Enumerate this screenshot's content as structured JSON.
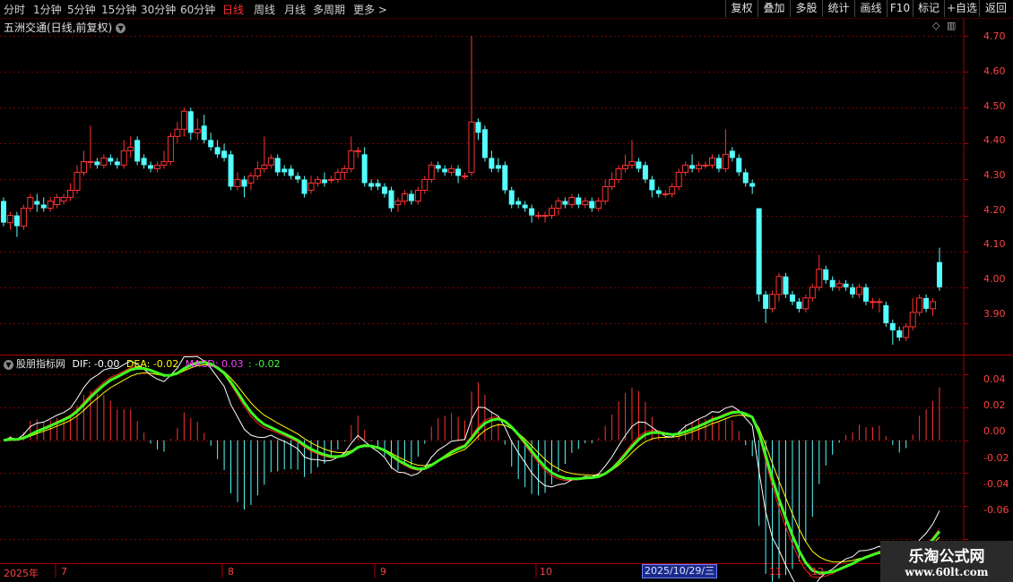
{
  "toolbar": {
    "periods": [
      "分时",
      "1分钟",
      "5分钟",
      "15分钟",
      "30分钟",
      "60分钟",
      "日线",
      "周线",
      "月线",
      "多周期",
      "更多 >"
    ],
    "active_period": "日线",
    "buttons": [
      "复权",
      "叠加",
      "多股",
      "统计",
      "画线",
      "F10",
      "标记",
      "+自选",
      "返回"
    ]
  },
  "stock_title": "五洲交通(日线,前复权)",
  "indicator": {
    "name": "股朋指标网",
    "dif_text": "DIF: -0.00",
    "dea_text": "DEA: -0.02",
    "macd_text": "MACD: 0.03",
    "extra_text": ": -0.02",
    "colors": {
      "dif": "#ffffff",
      "dea": "#ffff00",
      "macd": "#ff40ff",
      "extra": "#40ff40"
    }
  },
  "price_axis": [
    "4.70",
    "4.60",
    "4.50",
    "4.40",
    "4.30",
    "4.20",
    "4.10",
    "4.00",
    "3.90"
  ],
  "macd_axis": [
    "0.04",
    "0.02",
    "0.00",
    "-0.02",
    "-0.04",
    "-0.06"
  ],
  "x_axis": [
    "2025年",
    "7",
    "8",
    "9",
    "10",
    "11",
    "12"
  ],
  "cursor_date": "2025/10/29/三",
  "watermark": {
    "line1": "乐淘公式网",
    "line2": "www.60lt.com"
  },
  "colors": {
    "up": "#ff3232",
    "down": "#54ffff",
    "bg": "#000000",
    "grid": "#7a0000"
  },
  "chart_data": [
    {
      "type": "candlestick",
      "title": "五洲交通(日线,前复权)",
      "ylim": [
        3.82,
        4.72
      ],
      "candles": [
        [
          4.24,
          4.18,
          4.25,
          4.17
        ],
        [
          4.18,
          4.2,
          4.21,
          4.16
        ],
        [
          4.2,
          4.17,
          4.21,
          4.14
        ],
        [
          4.17,
          4.22,
          4.23,
          4.16
        ],
        [
          4.22,
          4.25,
          4.26,
          4.21
        ],
        [
          4.24,
          4.23,
          4.26,
          4.21
        ],
        [
          4.23,
          4.22,
          4.25,
          4.21
        ],
        [
          4.22,
          4.24,
          4.25,
          4.21
        ],
        [
          4.23,
          4.25,
          4.26,
          4.22
        ],
        [
          4.24,
          4.25,
          4.26,
          4.23
        ],
        [
          4.25,
          4.27,
          4.29,
          4.24
        ],
        [
          4.27,
          4.32,
          4.34,
          4.26
        ],
        [
          4.32,
          4.35,
          4.38,
          4.31
        ],
        [
          4.35,
          4.35,
          4.45,
          4.33
        ],
        [
          4.35,
          4.34,
          4.36,
          4.33
        ],
        [
          4.34,
          4.36,
          4.37,
          4.33
        ],
        [
          4.36,
          4.35,
          4.37,
          4.34
        ],
        [
          4.35,
          4.34,
          4.36,
          4.33
        ],
        [
          4.34,
          4.38,
          4.41,
          4.33
        ],
        [
          4.38,
          4.39,
          4.42,
          4.36
        ],
        [
          4.41,
          4.35,
          4.42,
          4.34
        ],
        [
          4.36,
          4.34,
          4.37,
          4.33
        ],
        [
          4.34,
          4.33,
          4.35,
          4.32
        ],
        [
          4.33,
          4.34,
          4.35,
          4.32
        ],
        [
          4.34,
          4.35,
          4.38,
          4.33
        ],
        [
          4.35,
          4.42,
          4.43,
          4.34
        ],
        [
          4.42,
          4.44,
          4.46,
          4.4
        ],
        [
          4.44,
          4.49,
          4.5,
          4.42
        ],
        [
          4.49,
          4.43,
          4.5,
          4.41
        ],
        [
          4.43,
          4.44,
          4.47,
          4.41
        ],
        [
          4.45,
          4.41,
          4.48,
          4.4
        ],
        [
          4.41,
          4.39,
          4.43,
          4.38
        ],
        [
          4.39,
          4.37,
          4.41,
          4.36
        ],
        [
          4.38,
          4.36,
          4.4,
          4.35
        ],
        [
          4.37,
          4.28,
          4.38,
          4.27
        ],
        [
          4.28,
          4.3,
          4.32,
          4.27
        ],
        [
          4.3,
          4.28,
          4.31,
          4.25
        ],
        [
          4.29,
          4.31,
          4.32,
          4.27
        ],
        [
          4.31,
          4.33,
          4.35,
          4.3
        ],
        [
          4.33,
          4.34,
          4.42,
          4.32
        ],
        [
          4.34,
          4.36,
          4.37,
          4.33
        ],
        [
          4.36,
          4.32,
          4.37,
          4.31
        ],
        [
          4.33,
          4.32,
          4.34,
          4.31
        ],
        [
          4.33,
          4.31,
          4.34,
          4.3
        ],
        [
          4.31,
          4.3,
          4.32,
          4.29
        ],
        [
          4.3,
          4.26,
          4.31,
          4.25
        ],
        [
          4.27,
          4.29,
          4.31,
          4.26
        ],
        [
          4.29,
          4.3,
          4.31,
          4.28
        ],
        [
          4.3,
          4.29,
          4.32,
          4.28
        ],
        [
          4.3,
          4.3,
          4.31,
          4.29
        ],
        [
          4.3,
          4.32,
          4.33,
          4.29
        ],
        [
          4.32,
          4.33,
          4.34,
          4.3
        ],
        [
          4.33,
          4.38,
          4.42,
          4.32
        ],
        [
          4.38,
          4.38,
          4.39,
          4.36
        ],
        [
          4.37,
          4.29,
          4.39,
          4.28
        ],
        [
          4.29,
          4.28,
          4.3,
          4.27
        ],
        [
          4.29,
          4.28,
          4.3,
          4.27
        ],
        [
          4.28,
          4.26,
          4.29,
          4.25
        ],
        [
          4.27,
          4.22,
          4.28,
          4.21
        ],
        [
          4.23,
          4.24,
          4.25,
          4.21
        ],
        [
          4.24,
          4.26,
          4.27,
          4.23
        ],
        [
          4.26,
          4.24,
          4.27,
          4.23
        ],
        [
          4.24,
          4.27,
          4.28,
          4.23
        ],
        [
          4.27,
          4.3,
          4.31,
          4.26
        ],
        [
          4.3,
          4.34,
          4.35,
          4.29
        ],
        [
          4.34,
          4.33,
          4.35,
          4.32
        ],
        [
          4.33,
          4.32,
          4.34,
          4.31
        ],
        [
          4.32,
          4.33,
          4.34,
          4.31
        ],
        [
          4.33,
          4.31,
          4.34,
          4.29
        ],
        [
          4.31,
          4.31,
          4.32,
          4.3
        ],
        [
          4.32,
          4.46,
          4.7,
          4.31
        ],
        [
          4.46,
          4.43,
          4.47,
          4.41
        ],
        [
          4.44,
          4.36,
          4.45,
          4.35
        ],
        [
          4.36,
          4.33,
          4.38,
          4.32
        ],
        [
          4.34,
          4.33,
          4.36,
          4.32
        ],
        [
          4.34,
          4.27,
          4.35,
          4.26
        ],
        [
          4.27,
          4.23,
          4.28,
          4.22
        ],
        [
          4.24,
          4.23,
          4.25,
          4.22
        ],
        [
          4.23,
          4.22,
          4.24,
          4.21
        ],
        [
          4.22,
          4.2,
          4.23,
          4.18
        ],
        [
          4.2,
          4.2,
          4.21,
          4.19
        ],
        [
          4.2,
          4.2,
          4.21,
          4.18
        ],
        [
          4.2,
          4.22,
          4.23,
          4.19
        ],
        [
          4.22,
          4.24,
          4.25,
          4.2
        ],
        [
          4.24,
          4.23,
          4.25,
          4.22
        ],
        [
          4.23,
          4.25,
          4.26,
          4.22
        ],
        [
          4.25,
          4.23,
          4.26,
          4.22
        ],
        [
          4.23,
          4.24,
          4.25,
          4.22
        ],
        [
          4.24,
          4.22,
          4.25,
          4.21
        ],
        [
          4.22,
          4.24,
          4.25,
          4.21
        ],
        [
          4.24,
          4.28,
          4.3,
          4.23
        ],
        [
          4.28,
          4.3,
          4.32,
          4.27
        ],
        [
          4.3,
          4.33,
          4.34,
          4.29
        ],
        [
          4.33,
          4.34,
          4.37,
          4.32
        ],
        [
          4.34,
          4.35,
          4.41,
          4.33
        ],
        [
          4.35,
          4.33,
          4.36,
          4.32
        ],
        [
          4.34,
          4.3,
          4.35,
          4.29
        ],
        [
          4.3,
          4.27,
          4.31,
          4.25
        ],
        [
          4.27,
          4.26,
          4.28,
          4.25
        ],
        [
          4.26,
          4.26,
          4.27,
          4.25
        ],
        [
          4.26,
          4.28,
          4.29,
          4.25
        ],
        [
          4.28,
          4.32,
          4.33,
          4.27
        ],
        [
          4.32,
          4.34,
          4.35,
          4.31
        ],
        [
          4.34,
          4.33,
          4.37,
          4.32
        ],
        [
          4.33,
          4.34,
          4.35,
          4.32
        ],
        [
          4.34,
          4.34,
          4.35,
          4.33
        ],
        [
          4.34,
          4.36,
          4.37,
          4.33
        ],
        [
          4.36,
          4.33,
          4.37,
          4.32
        ],
        [
          4.33,
          4.37,
          4.44,
          4.32
        ],
        [
          4.38,
          4.36,
          4.39,
          4.35
        ],
        [
          4.36,
          4.32,
          4.37,
          4.31
        ],
        [
          4.32,
          4.29,
          4.33,
          4.28
        ],
        [
          4.29,
          4.28,
          4.3,
          4.26
        ],
        [
          4.22,
          3.98,
          4.22,
          3.96
        ],
        [
          3.98,
          3.94,
          3.99,
          3.9
        ],
        [
          3.94,
          3.98,
          3.99,
          3.93
        ],
        [
          3.98,
          4.03,
          4.04,
          3.96
        ],
        [
          4.03,
          3.98,
          4.04,
          3.97
        ],
        [
          3.98,
          3.96,
          3.99,
          3.95
        ],
        [
          3.96,
          3.94,
          3.97,
          3.93
        ],
        [
          3.94,
          3.97,
          3.98,
          3.93
        ],
        [
          3.97,
          4.0,
          4.01,
          3.96
        ],
        [
          4.0,
          4.05,
          4.09,
          3.99
        ],
        [
          4.05,
          4.02,
          4.06,
          4.01
        ],
        [
          4.02,
          4.0,
          4.03,
          3.99
        ],
        [
          4.0,
          4.01,
          4.02,
          3.99
        ],
        [
          4.01,
          4.0,
          4.02,
          3.99
        ],
        [
          4.0,
          3.98,
          4.01,
          3.97
        ],
        [
          3.98,
          4.0,
          4.01,
          3.97
        ],
        [
          4.0,
          3.96,
          4.01,
          3.95
        ],
        [
          3.96,
          3.96,
          3.97,
          3.94
        ],
        [
          3.96,
          3.96,
          3.97,
          3.93
        ],
        [
          3.95,
          3.9,
          3.96,
          3.89
        ],
        [
          3.9,
          3.88,
          3.91,
          3.84
        ],
        [
          3.88,
          3.86,
          3.89,
          3.85
        ],
        [
          3.86,
          3.89,
          3.9,
          3.85
        ],
        [
          3.89,
          3.93,
          3.97,
          3.88
        ],
        [
          3.93,
          3.97,
          3.98,
          3.92
        ],
        [
          3.97,
          3.94,
          3.98,
          3.93
        ],
        [
          3.94,
          3.96,
          3.97,
          3.92
        ],
        [
          4.07,
          4.0,
          4.11,
          3.99
        ]
      ]
    },
    {
      "type": "line",
      "title": "股朋指标网",
      "ylim": [
        -0.074,
        0.047
      ],
      "series_order": [
        "dif",
        "dea",
        "extra",
        "macd"
      ]
    }
  ]
}
